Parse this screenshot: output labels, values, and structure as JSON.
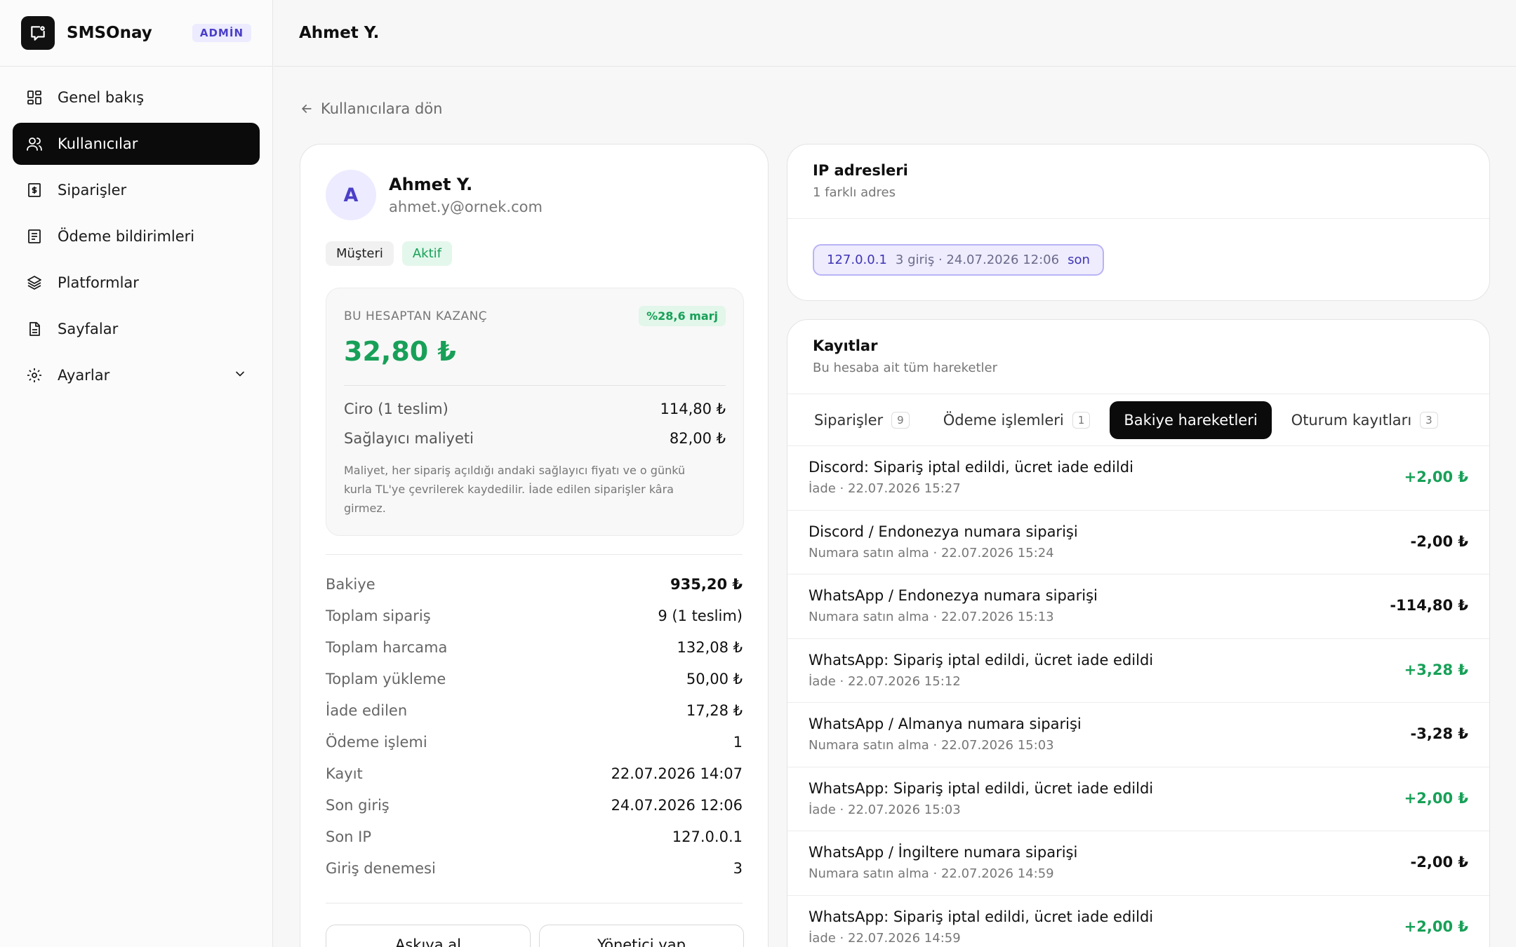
{
  "brand": {
    "name": "SMSOnay",
    "badge": "ADMİN"
  },
  "nav": [
    {
      "label": "Genel bakış",
      "icon": "grid-icon"
    },
    {
      "label": "Kullanıcılar",
      "icon": "users-icon",
      "active": true
    },
    {
      "label": "Siparişler",
      "icon": "receipt-icon"
    },
    {
      "label": "Ödeme bildirimleri",
      "icon": "document-icon"
    },
    {
      "label": "Platformlar",
      "icon": "layers-icon"
    },
    {
      "label": "Sayfalar",
      "icon": "file-icon"
    },
    {
      "label": "Ayarlar",
      "icon": "gear-icon"
    }
  ],
  "topbar": {
    "title": "Ahmet Y."
  },
  "back": {
    "label": "Kullanıcılara dön"
  },
  "user": {
    "initial": "A",
    "name": "Ahmet Y.",
    "email": "ahmet.y@ornek.com",
    "tags": [
      "Müşteri",
      "Aktif"
    ]
  },
  "earnings": {
    "label": "BU HESAPTAN KAZANÇ",
    "margin": "%28,6 marj",
    "value": "32,80 ₺",
    "rows": [
      {
        "label": "Ciro (1 teslim)",
        "value": "114,80 ₺"
      },
      {
        "label": "Sağlayıcı maliyeti",
        "value": "82,00 ₺"
      }
    ],
    "note": "Maliyet, her sipariş açıldığı andaki sağlayıcı fiyatı ve o günkü kurla TL'ye çevrilerek kaydedilir. İade edilen siparişler kâra girmez."
  },
  "stats": [
    {
      "label": "Bakiye",
      "value": "935,20 ₺",
      "bold": true
    },
    {
      "label": "Toplam sipariş",
      "value": "9 (1 teslim)"
    },
    {
      "label": "Toplam harcama",
      "value": "132,08 ₺"
    },
    {
      "label": "Toplam yükleme",
      "value": "50,00 ₺"
    },
    {
      "label": "İade edilen",
      "value": "17,28 ₺"
    },
    {
      "label": "Ödeme işlemi",
      "value": "1"
    },
    {
      "label": "Kayıt",
      "value": "22.07.2026 14:07"
    },
    {
      "label": "Son giriş",
      "value": "24.07.2026 12:06"
    },
    {
      "label": "Son IP",
      "value": "127.0.0.1"
    },
    {
      "label": "Giriş denemesi",
      "value": "3"
    }
  ],
  "actions": {
    "suspend": "Askıya al",
    "make_admin": "Yönetici yap"
  },
  "ip": {
    "title": "IP adresleri",
    "subtitle": "1 farklı adres",
    "chips": [
      {
        "address": "127.0.0.1",
        "meta": "3 giriş · 24.07.2026 12:06",
        "tag": "son"
      }
    ]
  },
  "logs": {
    "title": "Kayıtlar",
    "subtitle": "Bu hesaba ait tüm hareketler",
    "tabs": [
      {
        "label": "Siparişler",
        "count": "9"
      },
      {
        "label": "Ödeme işlemleri",
        "count": "1"
      },
      {
        "label": "Bakiye hareketleri",
        "count": "",
        "active": true
      },
      {
        "label": "Oturum kayıtları",
        "count": "3"
      }
    ],
    "rows": [
      {
        "title": "Discord: Sipariş iptal edildi, ücret iade edildi",
        "sub": "İade · 22.07.2026 15:27",
        "amount": "+2,00 ₺",
        "positive": true
      },
      {
        "title": "Discord / Endonezya numara siparişi",
        "sub": "Numara satın alma · 22.07.2026 15:24",
        "amount": "-2,00 ₺",
        "positive": false
      },
      {
        "title": "WhatsApp / Endonezya numara siparişi",
        "sub": "Numara satın alma · 22.07.2026 15:13",
        "amount": "-114,80 ₺",
        "positive": false
      },
      {
        "title": "WhatsApp: Sipariş iptal edildi, ücret iade edildi",
        "sub": "İade · 22.07.2026 15:12",
        "amount": "+3,28 ₺",
        "positive": true
      },
      {
        "title": "WhatsApp / Almanya numara siparişi",
        "sub": "Numara satın alma · 22.07.2026 15:03",
        "amount": "-3,28 ₺",
        "positive": false
      },
      {
        "title": "WhatsApp: Sipariş iptal edildi, ücret iade edildi",
        "sub": "İade · 22.07.2026 15:03",
        "amount": "+2,00 ₺",
        "positive": true
      },
      {
        "title": "WhatsApp / İngiltere numara siparişi",
        "sub": "Numara satın alma · 22.07.2026 14:59",
        "amount": "-2,00 ₺",
        "positive": false
      },
      {
        "title": "WhatsApp: Sipariş iptal edildi, ücret iade edildi",
        "sub": "İade · 22.07.2026 14:59",
        "amount": "+2,00 ₺",
        "positive": true
      }
    ]
  },
  "colors": {
    "accent": "#4b3fc7",
    "positive": "#18a058",
    "dark": "#0b0b0b"
  }
}
